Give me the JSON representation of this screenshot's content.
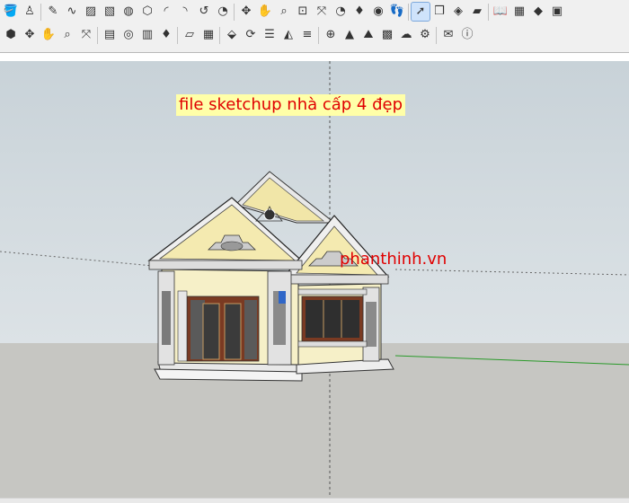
{
  "app": {
    "accent_active": "#cfe3fb",
    "sky_color": "#d3dbe0",
    "ground_color": "#c6c6c2"
  },
  "toolbar_row1": [
    {
      "icon": "paint-bucket-icon",
      "glyph": "🪣"
    },
    {
      "icon": "person-icon",
      "glyph": "♙"
    },
    {
      "icon": "pencil-icon",
      "glyph": "✎"
    },
    {
      "icon": "freehand-icon",
      "glyph": "∿"
    },
    {
      "icon": "rectangle-icon",
      "glyph": "▨"
    },
    {
      "icon": "rotated-rectangle-icon",
      "glyph": "▧"
    },
    {
      "icon": "circle-icon",
      "glyph": "◍"
    },
    {
      "icon": "polygon-icon",
      "glyph": "⬡"
    },
    {
      "icon": "arc-icon",
      "glyph": "◜"
    },
    {
      "icon": "two-point-arc-icon",
      "glyph": "◝"
    },
    {
      "icon": "three-point-arc-icon",
      "glyph": "↺"
    },
    {
      "icon": "pie-icon",
      "glyph": "◔"
    },
    {
      "icon": "orbit-icon",
      "glyph": "✥"
    },
    {
      "icon": "pan-icon",
      "glyph": "✋"
    },
    {
      "icon": "zoom-icon",
      "glyph": "⌕"
    },
    {
      "icon": "zoom-window-icon",
      "glyph": "⊡"
    },
    {
      "icon": "zoom-extents-icon",
      "glyph": "⤧"
    },
    {
      "icon": "previous-view-icon",
      "glyph": "◔"
    },
    {
      "icon": "position-camera-icon",
      "glyph": "♦"
    },
    {
      "icon": "look-around-icon",
      "glyph": "◉"
    },
    {
      "icon": "walk-icon",
      "glyph": "👣"
    },
    {
      "icon": "select-icon",
      "glyph": "➚"
    },
    {
      "icon": "make-component-icon",
      "glyph": "❒"
    },
    {
      "icon": "paint-icon",
      "glyph": "◈"
    },
    {
      "icon": "eraser-icon",
      "glyph": "▰"
    },
    {
      "icon": "book-icon",
      "glyph": "📖"
    },
    {
      "icon": "map-icon",
      "glyph": "▦"
    },
    {
      "icon": "geo-location-icon",
      "glyph": "◆"
    },
    {
      "icon": "photo-texture-icon",
      "glyph": "▣"
    }
  ],
  "toolbar_row2": [
    {
      "icon": "layers-icon",
      "glyph": "⬢"
    },
    {
      "icon": "orbit-icon",
      "glyph": "✥"
    },
    {
      "icon": "pan-icon",
      "glyph": "✋"
    },
    {
      "icon": "zoom-icon",
      "glyph": "⌕"
    },
    {
      "icon": "zoom-extents-icon",
      "glyph": "⤧"
    },
    {
      "icon": "warehouse-icon",
      "glyph": "▤"
    },
    {
      "icon": "get-models-icon",
      "glyph": "◎"
    },
    {
      "icon": "share-model-icon",
      "glyph": "▥"
    },
    {
      "icon": "ruby-icon",
      "glyph": "♦"
    },
    {
      "icon": "section-plane-icon",
      "glyph": "▱"
    },
    {
      "icon": "brick-wall-icon",
      "glyph": "▦"
    },
    {
      "icon": "extension-warehouse-icon",
      "glyph": "⬙"
    },
    {
      "icon": "sync-icon",
      "glyph": "⟳"
    },
    {
      "icon": "layers-stack-icon",
      "glyph": "☰"
    },
    {
      "icon": "sandbox-icon",
      "glyph": "◭"
    },
    {
      "icon": "styles-icon",
      "glyph": "≡"
    },
    {
      "icon": "add-icon",
      "glyph": "⊕"
    },
    {
      "icon": "tree-icon",
      "glyph": "▲"
    },
    {
      "icon": "terrain-icon",
      "glyph": "⛰"
    },
    {
      "icon": "checker-sphere-icon",
      "glyph": "▩"
    },
    {
      "icon": "cloud-icon",
      "glyph": "☁"
    },
    {
      "icon": "gear-icon",
      "glyph": "⚙"
    },
    {
      "icon": "mail-icon",
      "glyph": "✉"
    },
    {
      "icon": "info-icon",
      "glyph": "ⓘ"
    }
  ],
  "viewport": {
    "title_label": "file sketchup nhà cấp 4 đẹp",
    "watermark": "phanthinh.vn"
  }
}
